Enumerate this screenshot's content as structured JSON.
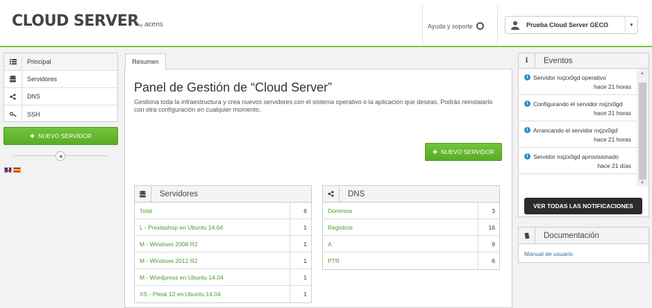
{
  "header": {
    "logo": "CLOUD SERVER",
    "logo_by": "by",
    "logo_brand": "acens",
    "support_label": "Ayuda y soporte",
    "user_name": "Prueba Cloud Server GECO"
  },
  "sidebar": {
    "items": [
      {
        "label": "Principal",
        "icon": "list-icon"
      },
      {
        "label": "Servidores",
        "icon": "database-icon"
      },
      {
        "label": "DNS",
        "icon": "share-icon"
      },
      {
        "label": "SSH",
        "icon": "key-icon"
      }
    ],
    "new_server_label": "NUEVO SERVIDOR"
  },
  "main": {
    "tab_label": "Resumen",
    "title": "Panel de Gestión de “Cloud Server”",
    "description": "Gestiona toda la infraestructura y crea nuevos servidores con el sistema operativo o la aplicación que deseas. Podrás reinstalarlo con otra configuración en cualquier momento.",
    "new_server_label": "NUEVO SERVIDOR"
  },
  "servers_panel": {
    "title": "Servidores",
    "rows": [
      {
        "name": "Total",
        "count": "6"
      },
      {
        "name": "L - Prestashop en Ubuntu 14.04",
        "count": "1"
      },
      {
        "name": "M - Windows 2008 R2",
        "count": "1"
      },
      {
        "name": "M - Windows 2012 R2",
        "count": "1"
      },
      {
        "name": "M - Wordpress en Ubuntu 14.04",
        "count": "1"
      },
      {
        "name": "XS - Plesk 12 en Ubuntu 14.04",
        "count": "1"
      }
    ]
  },
  "dns_panel": {
    "title": "DNS",
    "rows": [
      {
        "name": "Dominios",
        "count": "3"
      },
      {
        "name": "Registros",
        "count": "16"
      },
      {
        "name": "A",
        "count": "9"
      },
      {
        "name": "PTR",
        "count": "6"
      }
    ]
  },
  "events_panel": {
    "title": "Eventos",
    "events": [
      {
        "message": "Servidor nxjzx0gd operativo",
        "time": "hace 21 horas"
      },
      {
        "message": "Configurando el servidor nxjzx0gd",
        "time": "hace 21 horas"
      },
      {
        "message": "Arrancando el servidor nxjzx0gd",
        "time": "hace 21 horas"
      },
      {
        "message": "Servidor nxjzx0gd aprovisionado",
        "time": "hace 21 días"
      }
    ],
    "button_label": "VER TODAS LAS NOTIFICACIONES"
  },
  "docs_panel": {
    "title": "Documentación",
    "link_label": "Manual de usuario"
  },
  "colors": {
    "accent_green": "#5aab25",
    "link_green": "#4a9c2d",
    "info_blue": "#2a8ed0",
    "dark_button": "#2b2b2b"
  }
}
